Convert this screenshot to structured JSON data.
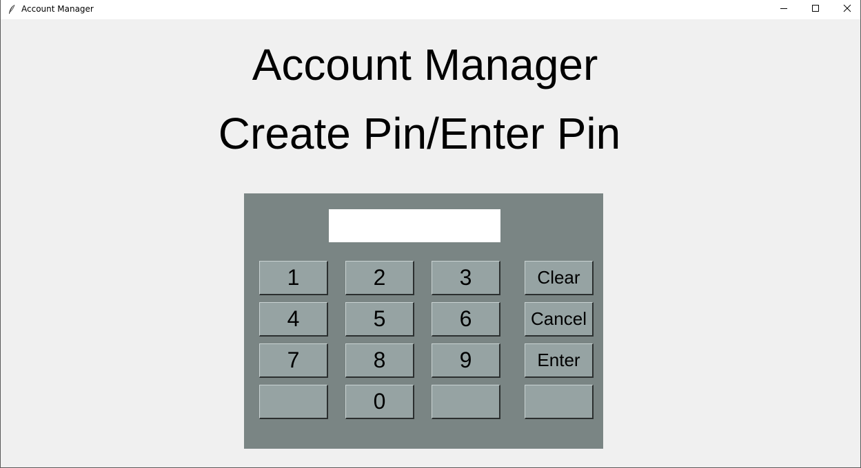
{
  "window": {
    "title": "Account Manager",
    "controls": {
      "minimize": "minimize-icon",
      "maximize": "maximize-icon",
      "close": "close-icon"
    }
  },
  "main": {
    "heading": "Account Manager",
    "subheading": "Create Pin/Enter Pin"
  },
  "keypad": {
    "pin_value": "",
    "keys": [
      "1",
      "2",
      "3",
      "Clear",
      "4",
      "5",
      "6",
      "Cancel",
      "7",
      "8",
      "9",
      "Enter",
      "",
      "0",
      "",
      ""
    ]
  },
  "colors": {
    "background": "#f0f0f0",
    "panel": "#7a8584",
    "key": "#96a3a3"
  }
}
